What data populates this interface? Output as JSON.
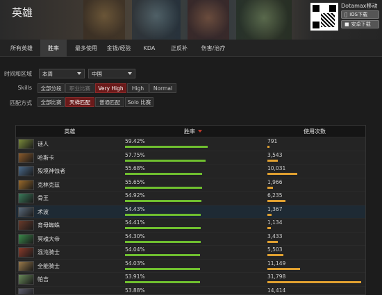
{
  "header": {
    "title": "英雄",
    "mobile_title": "Dotamax移动端",
    "ios_label": "iOS下载",
    "android_label": "安卓下载"
  },
  "nav": {
    "tabs": [
      {
        "label": "所有英雄",
        "active": false
      },
      {
        "label": "胜率",
        "active": true
      },
      {
        "label": "最多使用",
        "active": false
      },
      {
        "label": "金钱/经验",
        "active": false
      },
      {
        "label": "KDA",
        "active": false
      },
      {
        "label": "正反补",
        "active": false
      },
      {
        "label": "伤害/治疗",
        "active": false
      }
    ]
  },
  "filters": {
    "time_region_label": "时间和区域",
    "time_value": "本周",
    "region_value": "中国",
    "skills_label": "Skills",
    "skills": [
      {
        "label": "全部分段",
        "state": "normal"
      },
      {
        "label": "职业比赛",
        "state": "dim"
      },
      {
        "label": "Very High",
        "state": "on"
      },
      {
        "label": "High",
        "state": "normal"
      },
      {
        "label": "Normal",
        "state": "normal"
      }
    ],
    "match_type_label": "匹配方式",
    "match_types": [
      {
        "label": "全部比赛",
        "state": "normal"
      },
      {
        "label": "天梯匹配",
        "state": "on"
      },
      {
        "label": "普通匹配",
        "state": "normal"
      },
      {
        "label": "Solo 比赛",
        "state": "normal"
      }
    ]
  },
  "table": {
    "headers": {
      "hero": "英雄",
      "winrate": "胜率",
      "usage": "使用次数"
    },
    "rows": [
      {
        "hero": "谜人",
        "winrate": "59.42%",
        "wr": 59.42,
        "usage": "791",
        "use": 791,
        "color": "#7a8a3a"
      },
      {
        "hero": "哈斯卡",
        "winrate": "57.75%",
        "wr": 57.75,
        "usage": "3,543",
        "use": 3543,
        "color": "#8a5a2a"
      },
      {
        "hero": "殁境神蚀者",
        "winrate": "55.68%",
        "wr": 55.68,
        "usage": "10,031",
        "use": 10031,
        "color": "#4a6a8a"
      },
      {
        "hero": "克林克兹",
        "winrate": "55.65%",
        "wr": 55.65,
        "usage": "1,966",
        "use": 1966,
        "color": "#9a6a2a"
      },
      {
        "hero": "骨王",
        "winrate": "54.92%",
        "wr": 54.92,
        "usage": "6,235",
        "use": 6235,
        "color": "#3a7a5a"
      },
      {
        "hero": "术波",
        "winrate": "54.43%",
        "wr": 54.43,
        "usage": "1,367",
        "use": 1367,
        "color": "#5a6a7a",
        "highlight": true
      },
      {
        "hero": "育母蜘蛛",
        "winrate": "54.41%",
        "wr": 54.41,
        "usage": "1,134",
        "use": 1134,
        "color": "#6a3a2a"
      },
      {
        "hero": "冥魂大帝",
        "winrate": "54.30%",
        "wr": 54.3,
        "usage": "3,433",
        "use": 3433,
        "color": "#3a8a4a"
      },
      {
        "hero": "混沌骑士",
        "winrate": "54.04%",
        "wr": 54.04,
        "usage": "5,503",
        "use": 5503,
        "color": "#8a3a2a"
      },
      {
        "hero": "全能骑士",
        "winrate": "54.03%",
        "wr": 54.03,
        "usage": "11,149",
        "use": 11149,
        "color": "#9a7a4a"
      },
      {
        "hero": "帕吉",
        "winrate": "53.91%",
        "wr": 53.91,
        "usage": "31,798",
        "use": 31798,
        "color": "#6a8a5a"
      },
      {
        "hero": "",
        "winrate": "53.88%",
        "wr": 53.88,
        "usage": "14,414",
        "use": 14414,
        "color": "#5a5a6a"
      }
    ]
  },
  "colors": {
    "accent": "#c0392b",
    "winrate_bar": "#6fbf2f",
    "usage_bar": "#e0a030"
  }
}
